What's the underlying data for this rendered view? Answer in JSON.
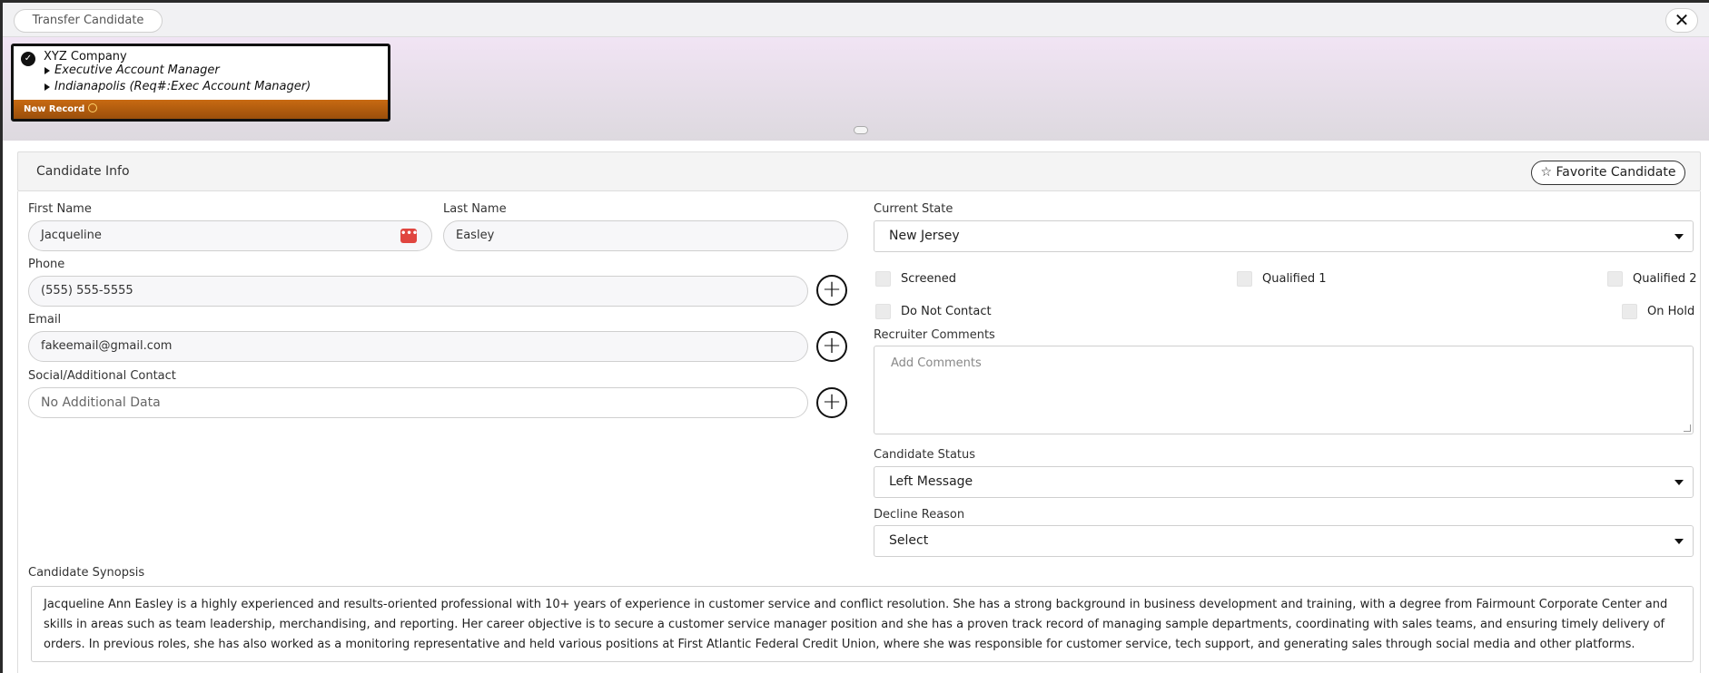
{
  "topbar": {
    "transfer_label": "Transfer Candidate",
    "close_glyph": "✕"
  },
  "record": {
    "company": "XYZ Company",
    "position": "Executive Account Manager",
    "location": "Indianapolis (Req#:Exec Account Manager)",
    "footer_label": "New Record"
  },
  "section": {
    "title": "Candidate Info",
    "favorite_label": "Favorite Candidate",
    "favorite_glyph": "☆"
  },
  "form": {
    "first_name": {
      "label": "First Name",
      "value": "Jacqueline"
    },
    "last_name": {
      "label": "Last Name",
      "value": "Easley"
    },
    "phone": {
      "label": "Phone",
      "value": "(555) 555-5555"
    },
    "email": {
      "label": "Email",
      "value": "fakeemail@gmail.com"
    },
    "social": {
      "label": "Social/Additional Contact",
      "value": "No Additional Data"
    },
    "current_state": {
      "label": "Current State",
      "value": "New Jersey"
    },
    "checkboxes": {
      "screened": "Screened",
      "qualified1": "Qualified 1",
      "qualified2": "Qualified 2",
      "do_not_contact": "Do Not Contact",
      "on_hold": "On Hold"
    },
    "recruiter_comments": {
      "label": "Recruiter Comments",
      "placeholder": "Add Comments"
    },
    "candidate_status": {
      "label": "Candidate Status",
      "value": "Left Message"
    },
    "decline_reason": {
      "label": "Decline Reason",
      "value": "Select"
    },
    "synopsis": {
      "label": "Candidate Synopsis",
      "text": "Jacqueline Ann Easley is a highly experienced and results-oriented professional with 10+ years of experience in customer service and conflict resolution. She has a strong background in business development and training, with a degree from Fairmount Corporate Center and skills in areas such as team leadership, merchandising, and reporting. Her career objective is to secure a customer service manager position and she has a proven track record of managing sample departments, coordinating with sales teams, and ensuring timely delivery of orders. In previous roles, she has also worked as a monitoring representative and held various positions at First Atlantic Federal Credit Union, where she was responsible for customer service, tech support, and generating sales through social media and other platforms."
    }
  },
  "colors": {
    "record_footer": "#b45f0f",
    "header_gradient_top": "#f1e4f4",
    "autofill_icon": "#e0453f"
  }
}
